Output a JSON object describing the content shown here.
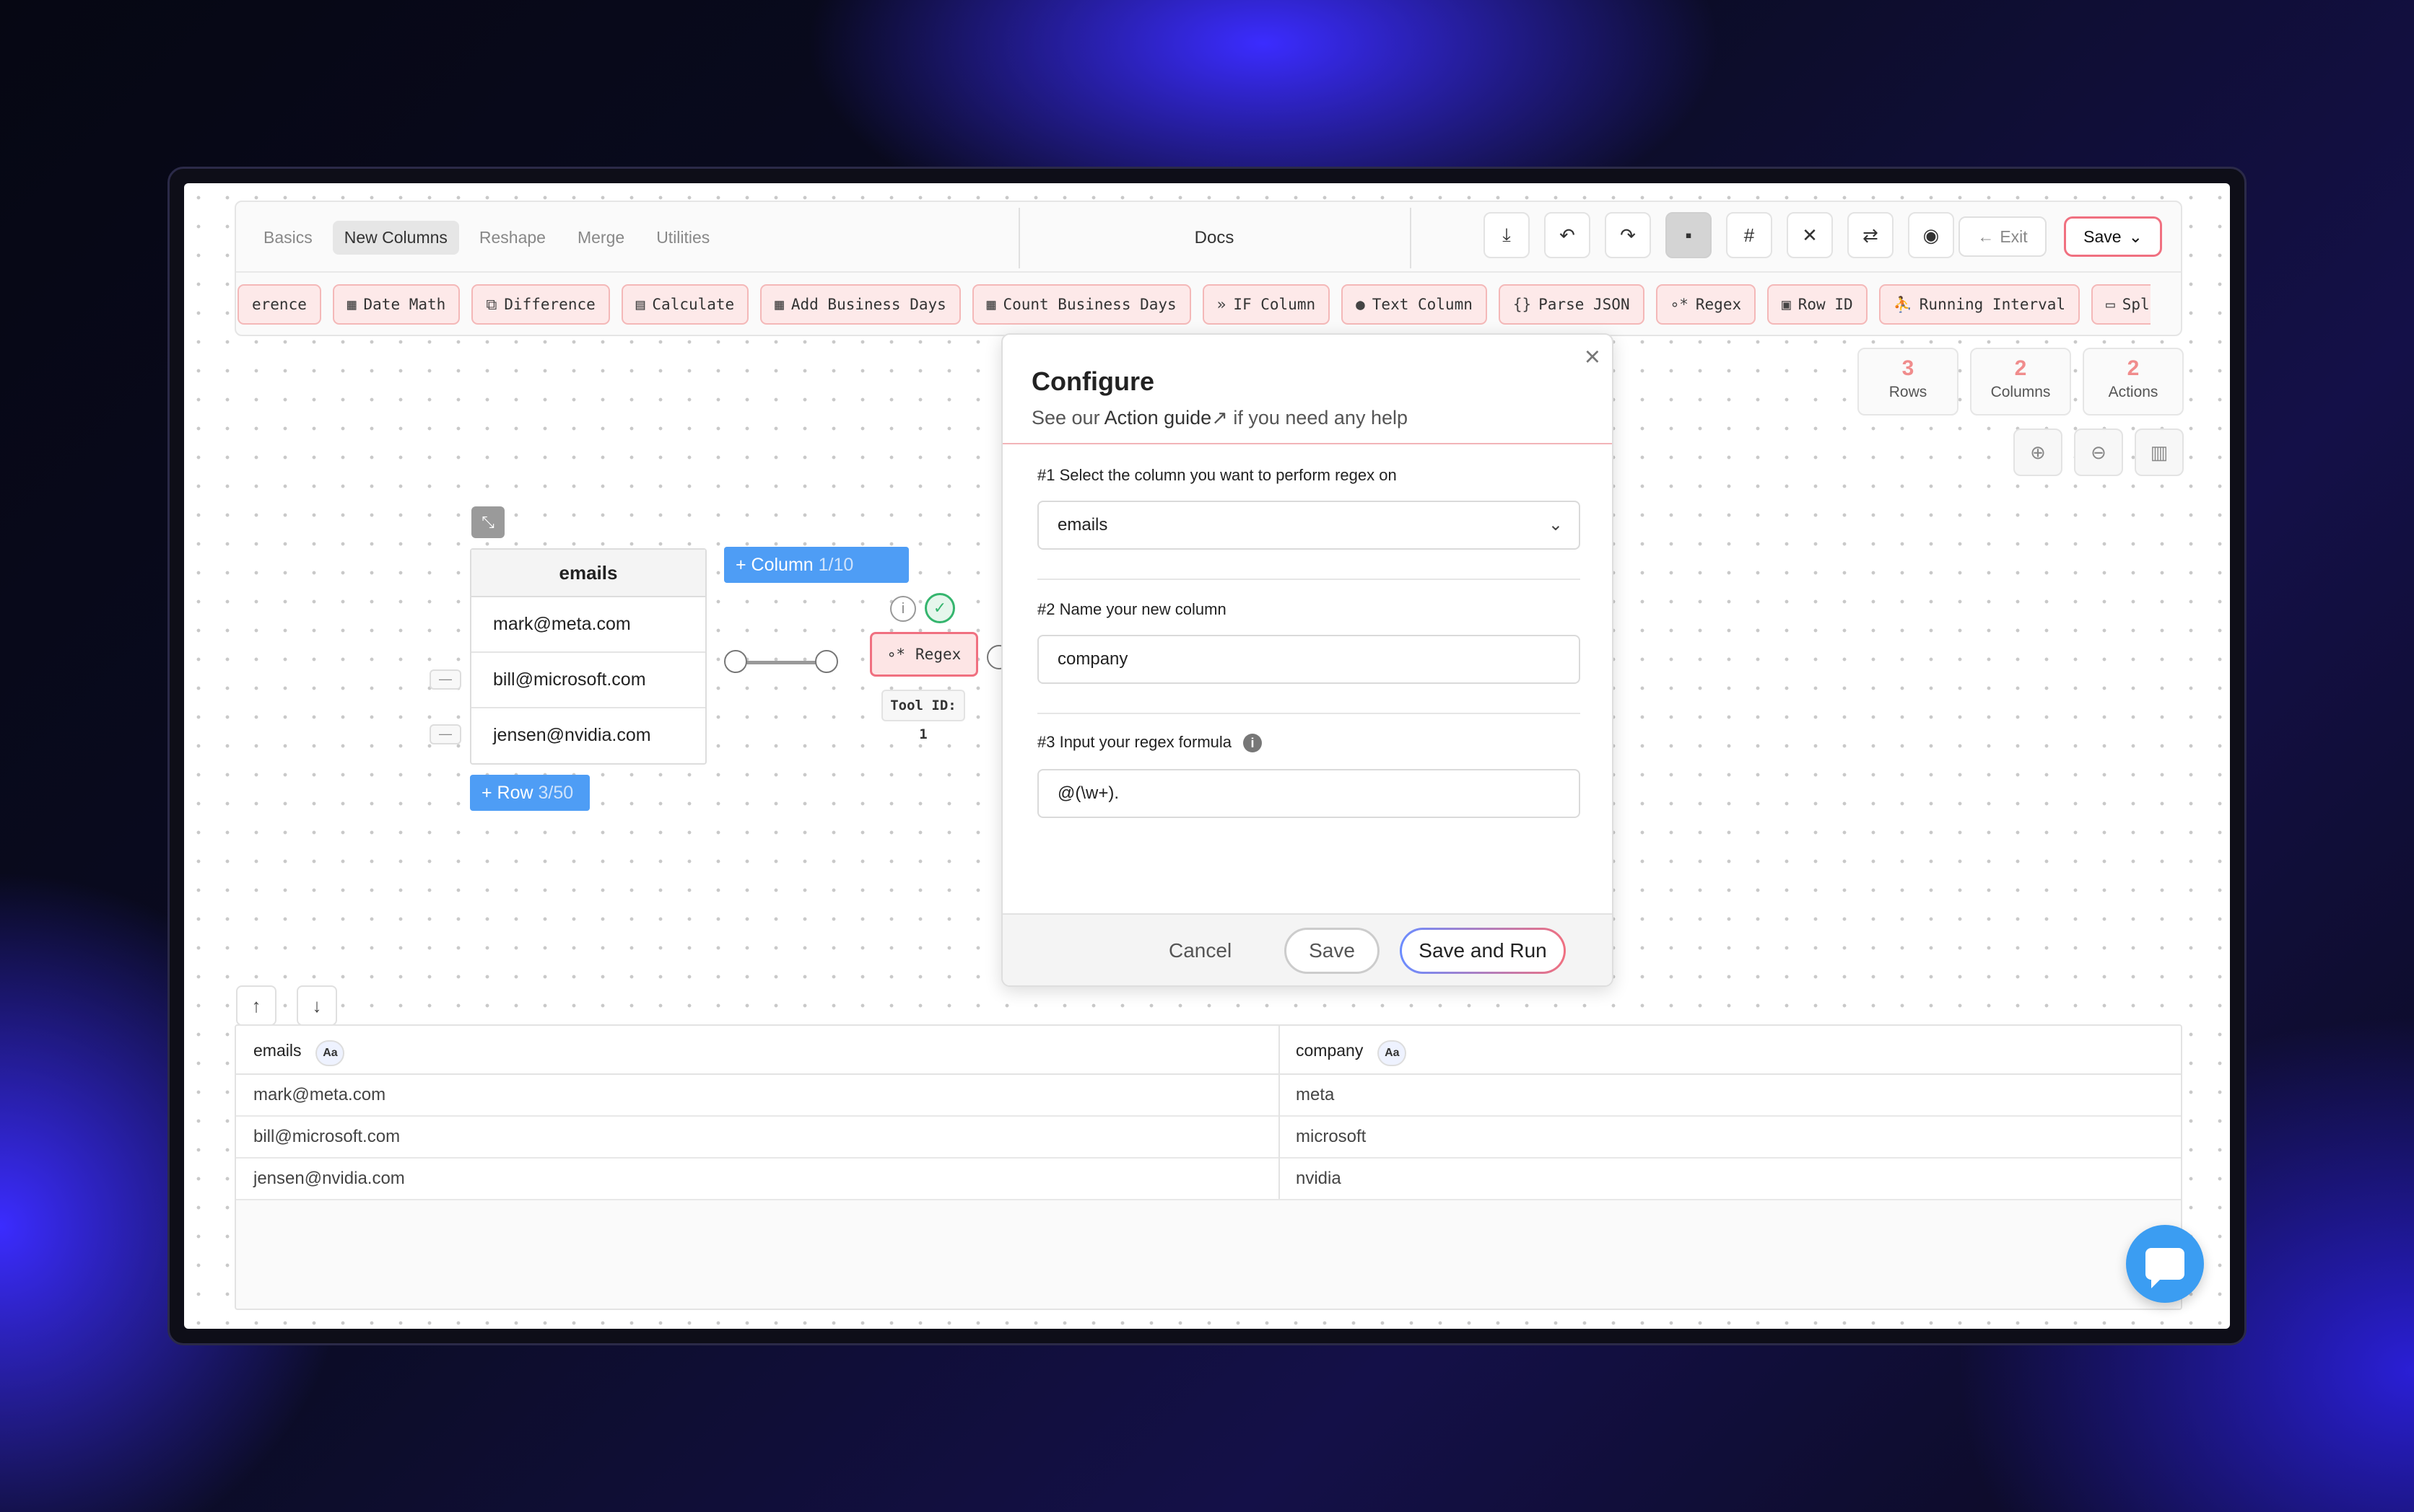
{
  "toolbar": {
    "tabs": [
      "Basics",
      "New Columns",
      "Reshape",
      "Merge",
      "Utilities"
    ],
    "active_tab": "New Columns",
    "docs_label": "Docs",
    "icons": [
      "download-icon",
      "undo-icon",
      "redo-icon",
      "note-icon",
      "grid-icon",
      "close-icon",
      "swap-icon",
      "record-icon"
    ],
    "exit_label": "Exit",
    "save_label": "Save"
  },
  "actions": [
    {
      "label": "erence",
      "icon": "diff-icon"
    },
    {
      "label": "Date Math",
      "icon": "calendar-icon"
    },
    {
      "label": "Difference",
      "icon": "diff-icon"
    },
    {
      "label": "Calculate",
      "icon": "calculator-icon"
    },
    {
      "label": "Add Business Days",
      "icon": "calendar-icon"
    },
    {
      "label": "Count Business Days",
      "icon": "calendar-icon"
    },
    {
      "label": "IF Column",
      "icon": "chevrons-icon"
    },
    {
      "label": "Text Column",
      "icon": "chat-icon"
    },
    {
      "label": "Parse JSON",
      "icon": "braces-icon"
    },
    {
      "label": "Regex",
      "icon": "regex-icon"
    },
    {
      "label": "Row ID",
      "icon": "id-icon"
    },
    {
      "label": "Running Interval",
      "icon": "runner-icon"
    },
    {
      "label": "Spl",
      "icon": "split-icon"
    }
  ],
  "stats": [
    {
      "value": "3",
      "label": "Rows"
    },
    {
      "value": "2",
      "label": "Columns"
    },
    {
      "value": "2",
      "label": "Actions"
    }
  ],
  "canvas": {
    "table_header": "emails",
    "rows": [
      "mark@meta.com",
      "bill@microsoft.com",
      "jensen@nvidia.com"
    ],
    "add_column": "+ Column",
    "add_column_count": "1/10",
    "add_row": "+ Row",
    "add_row_count": "3/50",
    "node_label": "Regex",
    "tool_id": "Tool ID: 1"
  },
  "modal": {
    "title": "Configure",
    "subtitle_prefix": "See our ",
    "subtitle_link": "Action guide",
    "subtitle_suffix": " if you need any help",
    "step1_label": "#1 Select the column you want to perform regex on",
    "step1_value": "emails",
    "step2_label": "#2 Name your new column",
    "step2_value": "company",
    "step3_label": "#3 Input your regex formula",
    "step3_value": "@(\\w+).",
    "cancel": "Cancel",
    "save": "Save",
    "save_run": "Save and Run"
  },
  "results": {
    "columns": [
      {
        "name": "emails",
        "type": "Aa"
      },
      {
        "name": "company",
        "type": "Aa"
      }
    ],
    "rows": [
      [
        "mark@meta.com",
        "meta"
      ],
      [
        "bill@microsoft.com",
        "microsoft"
      ],
      [
        "jensen@nvidia.com",
        "nvidia"
      ]
    ]
  }
}
